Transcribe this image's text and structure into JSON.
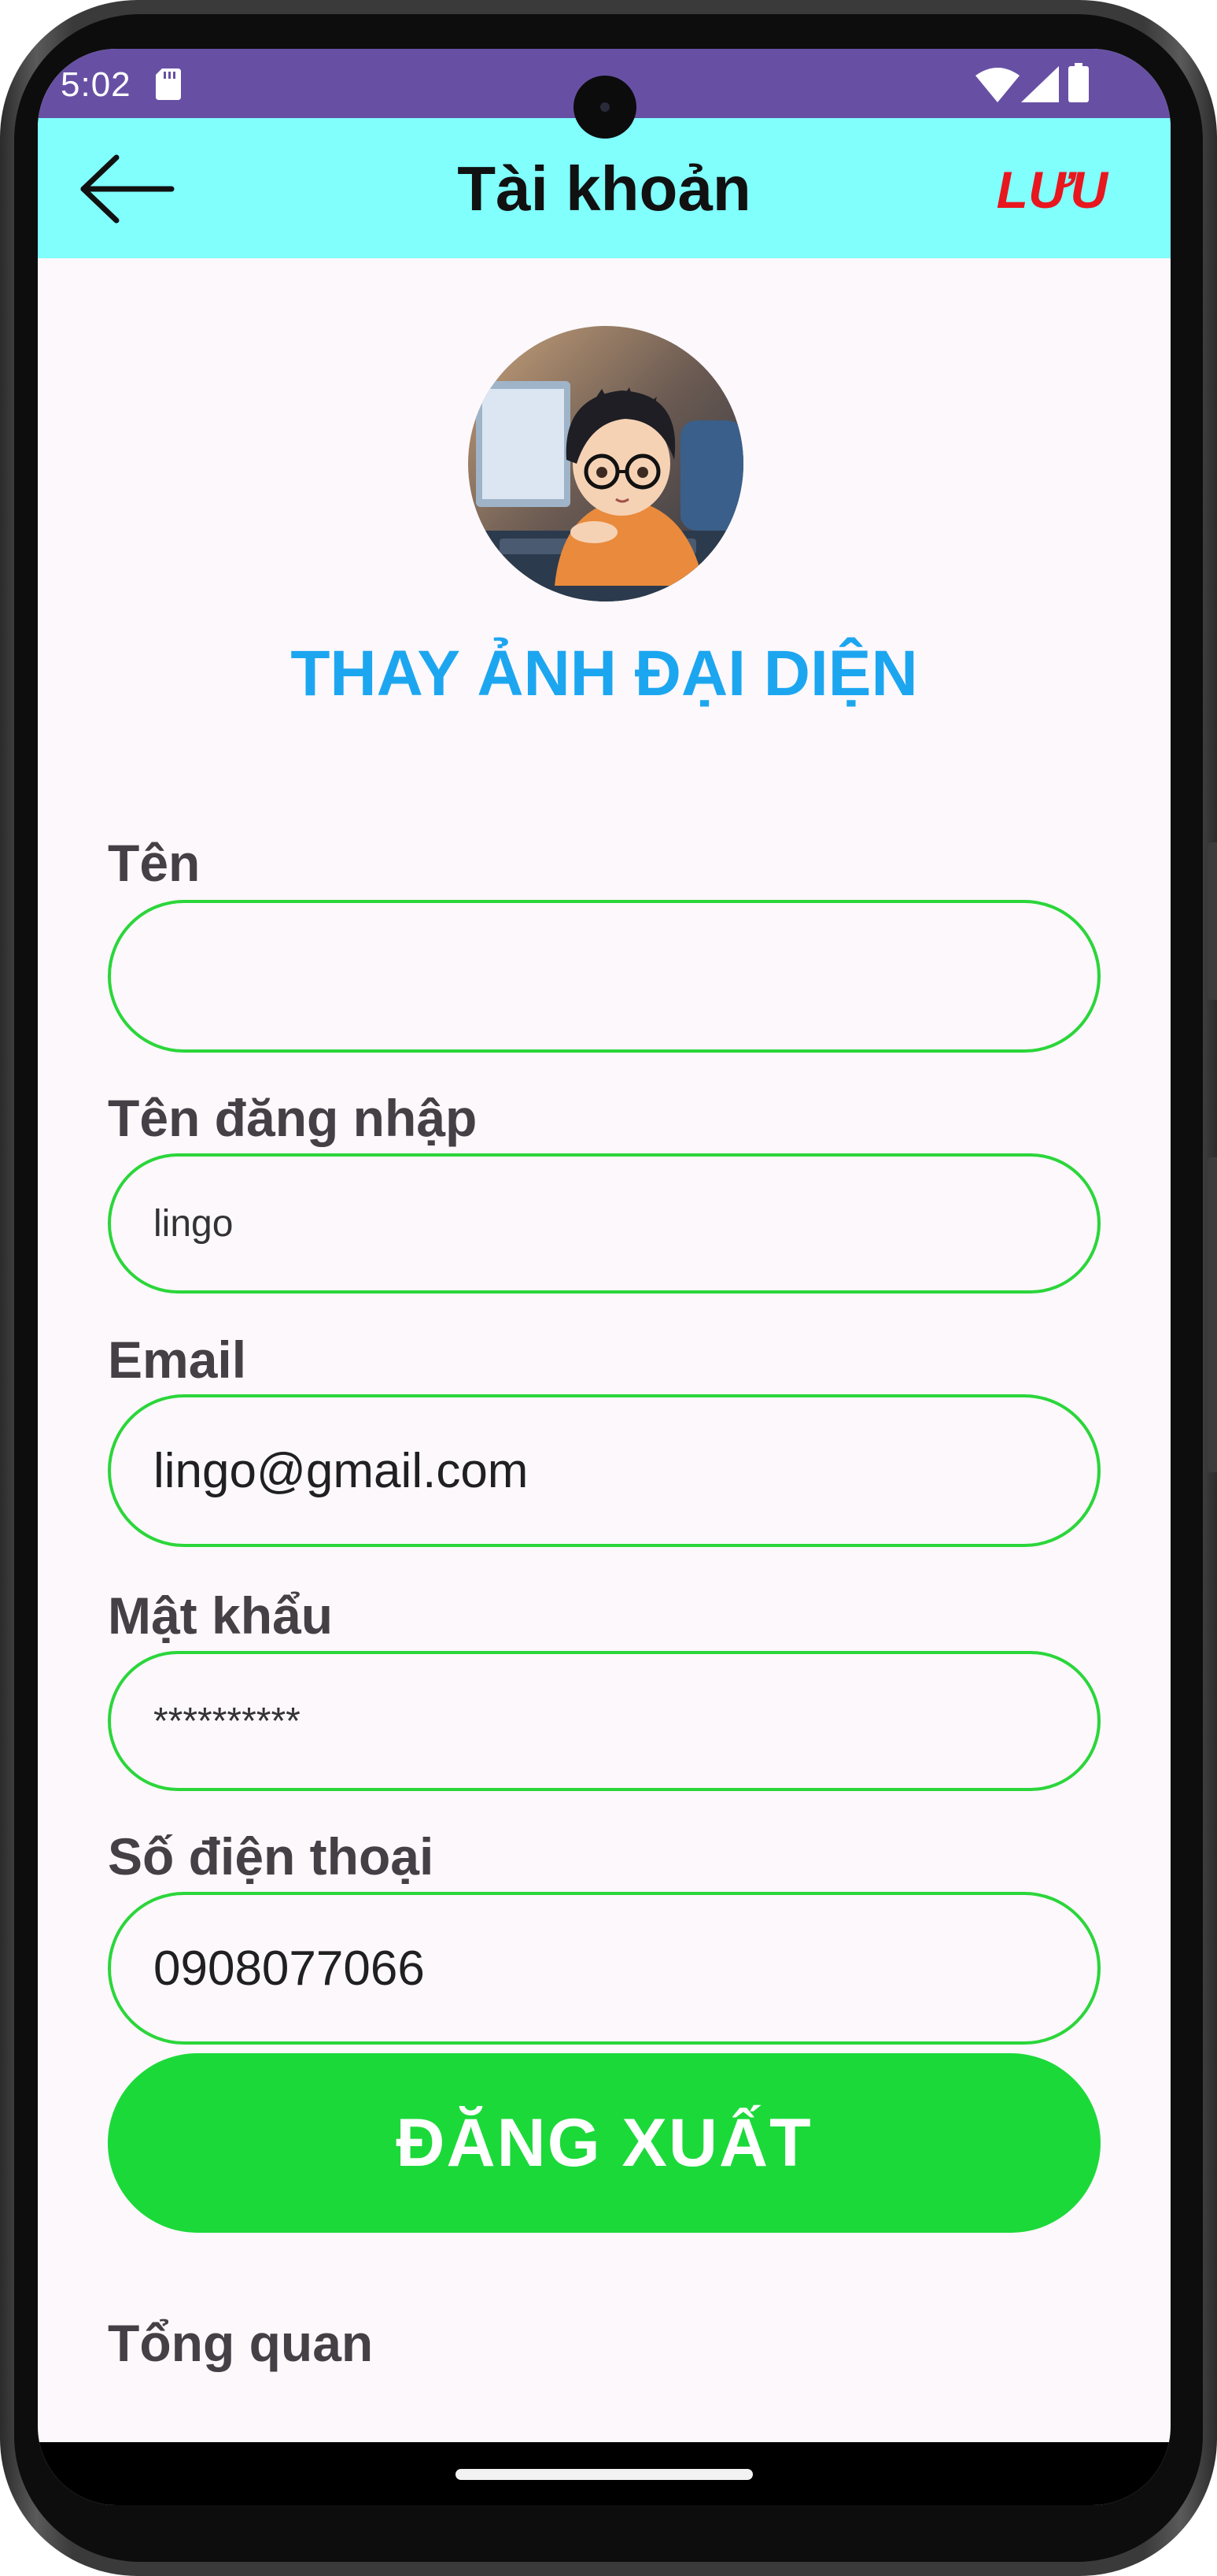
{
  "status_bar": {
    "time": "5:02",
    "icons": [
      "sd-card-icon",
      "wifi-icon",
      "signal-icon",
      "battery-icon"
    ],
    "background": "#6750a4"
  },
  "app_bar": {
    "title": "Tài khoản",
    "back_icon": "arrow-left-icon",
    "save_label": "LƯU",
    "background": "#80fffd",
    "save_color": "#e8161e"
  },
  "profile": {
    "change_avatar_label": "THAY ẢNH ĐẠI DIỆN",
    "accent": "#1da6f0"
  },
  "form": {
    "name": {
      "label": "Tên",
      "value": ""
    },
    "username": {
      "label": "Tên đăng nhập",
      "value": "lingo"
    },
    "email": {
      "label": "Email",
      "value": "lingo@gmail.com"
    },
    "password": {
      "label": "Mật khẩu",
      "value": "**********"
    },
    "phone": {
      "label": "Số điện thoại",
      "value": "0908077066"
    },
    "border_color": "#2bd63a"
  },
  "actions": {
    "logout_label": "ĐĂNG XUẤT",
    "logout_color": "#1cd93a"
  },
  "overview": {
    "label": "Tổng quan"
  }
}
